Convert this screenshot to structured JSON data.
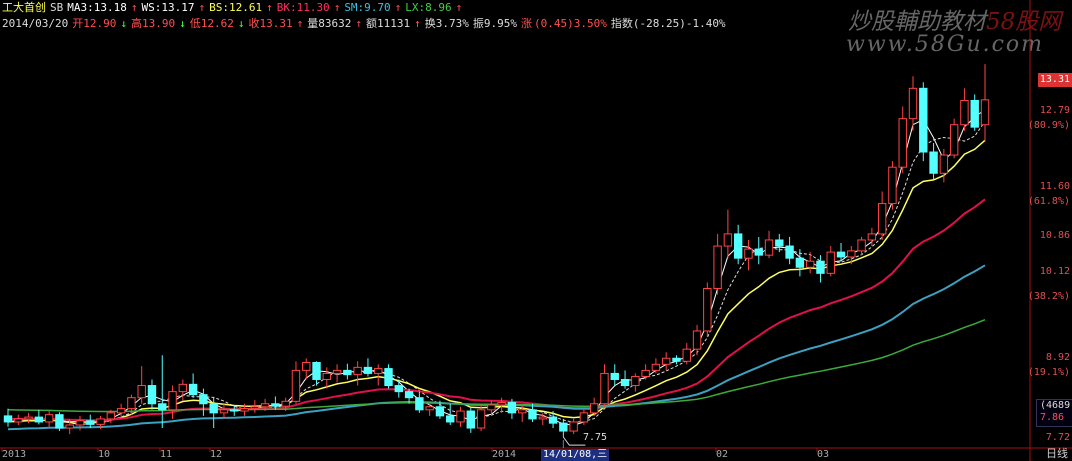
{
  "header": {
    "stock_name": "工大首创",
    "indicator": "SB",
    "ma3": "MA3:13.18",
    "ws": "WS:13.17",
    "bs": "BS:12.61",
    "bk": "BK:11.30",
    "sm": "SM:9.70",
    "lx": "LX:8.96",
    "date": "2014/03/20",
    "open": "开12.90",
    "high": "高13.90",
    "low": "低12.62",
    "close": "收13.31",
    "volume": "量83632",
    "amount": "额11131",
    "turnover": "换3.73%",
    "amplitude": "振9.95%",
    "change_label": "涨",
    "change_value": "(0.45)3.50%",
    "index": "指数(-28.25)-1.40%"
  },
  "watermark": {
    "line1": "炒股輔助教材",
    "line1_brand": "58股网",
    "line2": "www.58Gu.com"
  },
  "price_axis": {
    "labels": [
      "13.31",
      "12.79",
      "(80.9%)",
      "11.60",
      "(61.8%)",
      "10.86",
      "10.12",
      "(38.2%)",
      "8.92",
      "(19.1%)",
      "7.72"
    ],
    "current": "13.31",
    "volume_box": [
      "(4689)",
      "7.86"
    ]
  },
  "low_marker": "7.75",
  "x_axis": {
    "labels": [
      "2013",
      "10",
      "11",
      "12",
      "2014",
      "02",
      "03"
    ],
    "cursor_date": "14/01/08,三",
    "period": "日线"
  },
  "colors": {
    "up": "#ff4444",
    "down": "#54ffff",
    "ma_white": "#ffffff",
    "ma_yellow": "#ffff60",
    "ma_red": "#e0104a",
    "ma_teal": "#3ca0c0",
    "ma_green": "#3caa3c"
  },
  "chart_data": {
    "type": "candlestick",
    "x_range": [
      "2013/09",
      "2014/03/20"
    ],
    "y_range": [
      7.72,
      13.9
    ],
    "candles": [
      {
        "o": 8.1,
        "h": 8.22,
        "l": 7.92,
        "c": 8.0
      },
      {
        "o": 8.0,
        "h": 8.12,
        "l": 7.95,
        "c": 8.05
      },
      {
        "o": 8.05,
        "h": 8.15,
        "l": 7.98,
        "c": 8.08
      },
      {
        "o": 8.08,
        "h": 8.2,
        "l": 7.96,
        "c": 8.0
      },
      {
        "o": 8.0,
        "h": 8.18,
        "l": 7.9,
        "c": 8.12
      },
      {
        "o": 8.12,
        "h": 8.16,
        "l": 7.85,
        "c": 7.9
      },
      {
        "o": 7.9,
        "h": 8.05,
        "l": 7.8,
        "c": 7.95
      },
      {
        "o": 7.95,
        "h": 8.1,
        "l": 7.86,
        "c": 8.02
      },
      {
        "o": 8.02,
        "h": 8.12,
        "l": 7.9,
        "c": 7.96
      },
      {
        "o": 7.96,
        "h": 8.1,
        "l": 7.88,
        "c": 8.05
      },
      {
        "o": 8.05,
        "h": 8.2,
        "l": 7.98,
        "c": 8.15
      },
      {
        "o": 8.15,
        "h": 8.3,
        "l": 8.05,
        "c": 8.22
      },
      {
        "o": 8.22,
        "h": 8.45,
        "l": 8.12,
        "c": 8.4
      },
      {
        "o": 8.4,
        "h": 8.92,
        "l": 8.3,
        "c": 8.6
      },
      {
        "o": 8.6,
        "h": 8.7,
        "l": 8.2,
        "c": 8.3
      },
      {
        "o": 8.3,
        "h": 9.1,
        "l": 7.9,
        "c": 8.2
      },
      {
        "o": 8.2,
        "h": 8.6,
        "l": 8.05,
        "c": 8.5
      },
      {
        "o": 8.5,
        "h": 8.7,
        "l": 8.35,
        "c": 8.62
      },
      {
        "o": 8.62,
        "h": 8.8,
        "l": 8.4,
        "c": 8.45
      },
      {
        "o": 8.45,
        "h": 8.55,
        "l": 8.1,
        "c": 8.3
      },
      {
        "o": 8.3,
        "h": 8.4,
        "l": 7.9,
        "c": 8.15
      },
      {
        "o": 8.15,
        "h": 8.3,
        "l": 8.05,
        "c": 8.2
      },
      {
        "o": 8.2,
        "h": 8.28,
        "l": 8.1,
        "c": 8.18
      },
      {
        "o": 8.18,
        "h": 8.3,
        "l": 8.1,
        "c": 8.22
      },
      {
        "o": 8.22,
        "h": 8.36,
        "l": 8.15,
        "c": 8.25
      },
      {
        "o": 8.25,
        "h": 8.38,
        "l": 8.18,
        "c": 8.3
      },
      {
        "o": 8.3,
        "h": 8.42,
        "l": 8.2,
        "c": 8.26
      },
      {
        "o": 8.26,
        "h": 8.4,
        "l": 8.18,
        "c": 8.34
      },
      {
        "o": 8.34,
        "h": 9.0,
        "l": 8.3,
        "c": 8.85
      },
      {
        "o": 8.85,
        "h": 9.05,
        "l": 8.7,
        "c": 8.98
      },
      {
        "o": 8.98,
        "h": 9.0,
        "l": 8.6,
        "c": 8.7
      },
      {
        "o": 8.7,
        "h": 8.9,
        "l": 8.55,
        "c": 8.8
      },
      {
        "o": 8.8,
        "h": 8.95,
        "l": 8.65,
        "c": 8.85
      },
      {
        "o": 8.85,
        "h": 8.96,
        "l": 8.7,
        "c": 8.78
      },
      {
        "o": 8.78,
        "h": 9.0,
        "l": 8.6,
        "c": 8.9
      },
      {
        "o": 8.9,
        "h": 9.05,
        "l": 8.75,
        "c": 8.8
      },
      {
        "o": 8.8,
        "h": 8.95,
        "l": 8.6,
        "c": 8.88
      },
      {
        "o": 8.88,
        "h": 8.95,
        "l": 8.55,
        "c": 8.6
      },
      {
        "o": 8.6,
        "h": 8.7,
        "l": 8.4,
        "c": 8.5
      },
      {
        "o": 8.5,
        "h": 8.55,
        "l": 8.3,
        "c": 8.4
      },
      {
        "o": 8.4,
        "h": 8.5,
        "l": 8.15,
        "c": 8.2
      },
      {
        "o": 8.2,
        "h": 8.3,
        "l": 8.1,
        "c": 8.25
      },
      {
        "o": 8.25,
        "h": 8.35,
        "l": 8.05,
        "c": 8.1
      },
      {
        "o": 8.1,
        "h": 8.3,
        "l": 7.95,
        "c": 8.0
      },
      {
        "o": 8.0,
        "h": 8.25,
        "l": 7.92,
        "c": 8.18
      },
      {
        "o": 8.18,
        "h": 8.25,
        "l": 7.82,
        "c": 7.9
      },
      {
        "o": 7.9,
        "h": 8.3,
        "l": 7.85,
        "c": 8.2
      },
      {
        "o": 8.2,
        "h": 8.35,
        "l": 8.1,
        "c": 8.28
      },
      {
        "o": 8.28,
        "h": 8.4,
        "l": 8.15,
        "c": 8.32
      },
      {
        "o": 8.32,
        "h": 8.38,
        "l": 8.05,
        "c": 8.15
      },
      {
        "o": 8.15,
        "h": 8.28,
        "l": 8.0,
        "c": 8.2
      },
      {
        "o": 8.2,
        "h": 8.3,
        "l": 8.0,
        "c": 8.05
      },
      {
        "o": 8.05,
        "h": 8.15,
        "l": 7.95,
        "c": 8.08
      },
      {
        "o": 8.08,
        "h": 8.18,
        "l": 7.9,
        "c": 7.98
      },
      {
        "o": 7.98,
        "h": 8.05,
        "l": 7.75,
        "c": 7.85
      },
      {
        "o": 7.85,
        "h": 8.05,
        "l": 7.8,
        "c": 8.0
      },
      {
        "o": 8.0,
        "h": 8.2,
        "l": 7.95,
        "c": 8.15
      },
      {
        "o": 8.15,
        "h": 8.4,
        "l": 8.1,
        "c": 8.3
      },
      {
        "o": 8.3,
        "h": 8.95,
        "l": 8.25,
        "c": 8.8
      },
      {
        "o": 8.8,
        "h": 8.95,
        "l": 8.6,
        "c": 8.7
      },
      {
        "o": 8.7,
        "h": 8.85,
        "l": 8.55,
        "c": 8.6
      },
      {
        "o": 8.6,
        "h": 8.8,
        "l": 8.5,
        "c": 8.75
      },
      {
        "o": 8.75,
        "h": 8.95,
        "l": 8.7,
        "c": 8.85
      },
      {
        "o": 8.85,
        "h": 9.05,
        "l": 8.8,
        "c": 8.95
      },
      {
        "o": 8.95,
        "h": 9.15,
        "l": 8.85,
        "c": 9.05
      },
      {
        "o": 9.05,
        "h": 9.1,
        "l": 8.95,
        "c": 9.0
      },
      {
        "o": 9.0,
        "h": 9.3,
        "l": 8.95,
        "c": 9.2
      },
      {
        "o": 9.2,
        "h": 9.6,
        "l": 9.1,
        "c": 9.5
      },
      {
        "o": 9.5,
        "h": 10.3,
        "l": 9.4,
        "c": 10.2
      },
      {
        "o": 10.2,
        "h": 11.1,
        "l": 10.1,
        "c": 10.9
      },
      {
        "o": 10.9,
        "h": 11.5,
        "l": 10.7,
        "c": 11.1
      },
      {
        "o": 11.1,
        "h": 11.25,
        "l": 10.6,
        "c": 10.7
      },
      {
        "o": 10.7,
        "h": 11.0,
        "l": 10.5,
        "c": 10.85
      },
      {
        "o": 10.85,
        "h": 11.05,
        "l": 10.6,
        "c": 10.75
      },
      {
        "o": 10.75,
        "h": 11.15,
        "l": 10.7,
        "c": 11.0
      },
      {
        "o": 11.0,
        "h": 11.1,
        "l": 10.8,
        "c": 10.9
      },
      {
        "o": 10.9,
        "h": 11.05,
        "l": 10.6,
        "c": 10.7
      },
      {
        "o": 10.7,
        "h": 10.85,
        "l": 10.4,
        "c": 10.55
      },
      {
        "o": 10.55,
        "h": 10.8,
        "l": 10.45,
        "c": 10.65
      },
      {
        "o": 10.65,
        "h": 10.75,
        "l": 10.3,
        "c": 10.45
      },
      {
        "o": 10.45,
        "h": 10.9,
        "l": 10.4,
        "c": 10.8
      },
      {
        "o": 10.8,
        "h": 10.95,
        "l": 10.65,
        "c": 10.72
      },
      {
        "o": 10.72,
        "h": 10.9,
        "l": 10.6,
        "c": 10.82
      },
      {
        "o": 10.82,
        "h": 11.05,
        "l": 10.75,
        "c": 11.0
      },
      {
        "o": 11.0,
        "h": 11.2,
        "l": 10.9,
        "c": 11.1
      },
      {
        "o": 11.1,
        "h": 11.8,
        "l": 11.0,
        "c": 11.6
      },
      {
        "o": 11.6,
        "h": 12.3,
        "l": 11.5,
        "c": 12.2
      },
      {
        "o": 12.2,
        "h": 13.2,
        "l": 12.1,
        "c": 13.0
      },
      {
        "o": 13.0,
        "h": 13.7,
        "l": 12.8,
        "c": 13.5
      },
      {
        "o": 13.5,
        "h": 13.6,
        "l": 12.3,
        "c": 12.45
      },
      {
        "o": 12.45,
        "h": 12.6,
        "l": 12.0,
        "c": 12.1
      },
      {
        "o": 12.1,
        "h": 12.5,
        "l": 11.95,
        "c": 12.4
      },
      {
        "o": 12.4,
        "h": 13.0,
        "l": 12.35,
        "c": 12.9
      },
      {
        "o": 12.9,
        "h": 13.5,
        "l": 12.8,
        "c": 13.3
      },
      {
        "o": 13.3,
        "h": 13.4,
        "l": 12.8,
        "c": 12.86
      },
      {
        "o": 12.9,
        "h": 13.9,
        "l": 12.62,
        "c": 13.31
      }
    ],
    "ma_series": [
      {
        "name": "MA3",
        "color": "#ffffff",
        "style": "solid"
      },
      {
        "name": "WS",
        "color": "#dddddd",
        "style": "dashed"
      },
      {
        "name": "BS",
        "color": "#ffff60",
        "style": "solid"
      },
      {
        "name": "BK",
        "color": "#e0104a",
        "style": "solid"
      },
      {
        "name": "SM",
        "color": "#3ca0c0",
        "style": "solid"
      },
      {
        "name": "LX",
        "color": "#3caa3c",
        "style": "solid"
      }
    ],
    "ma_last_values": [
      13.18,
      13.17,
      12.61,
      11.3,
      9.7,
      8.96
    ],
    "annotations": {
      "low": 7.75
    }
  }
}
